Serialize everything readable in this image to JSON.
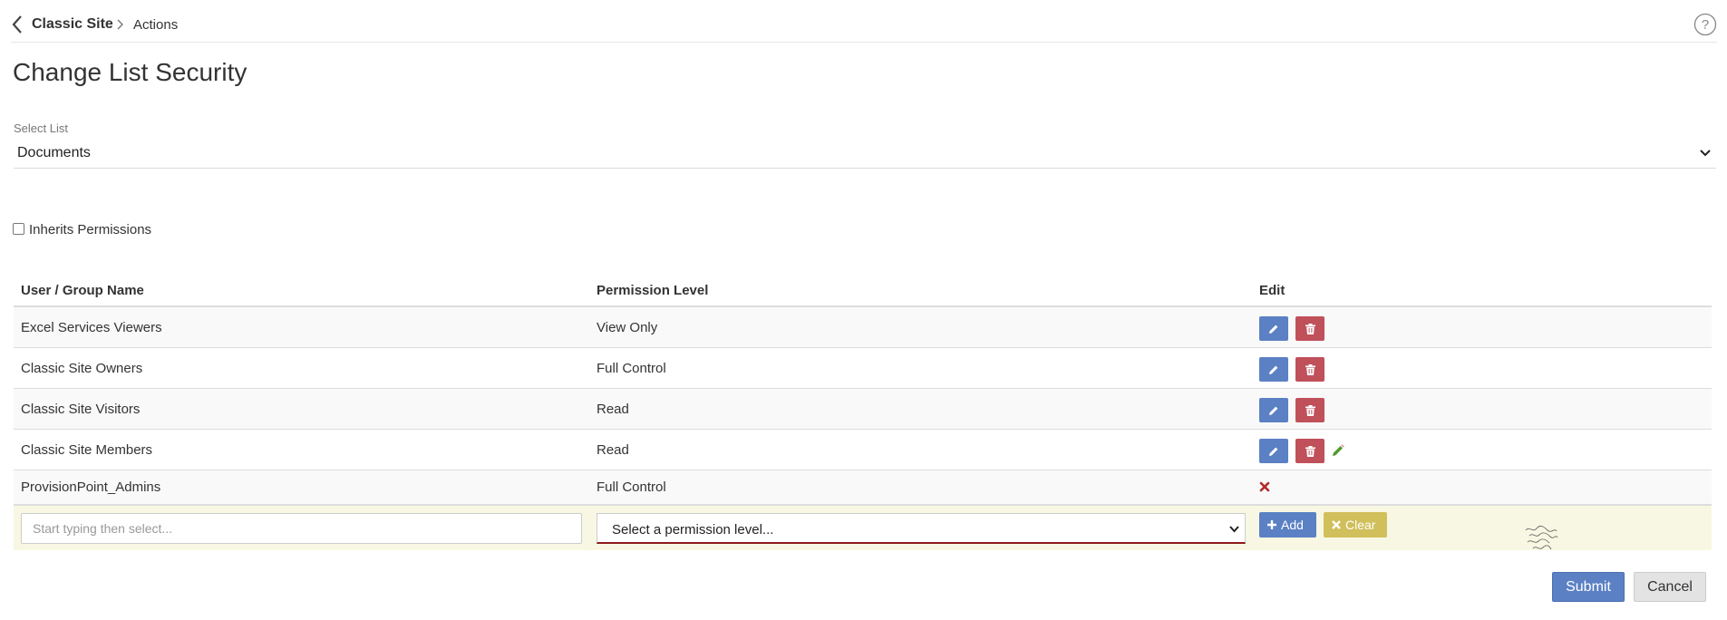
{
  "breadcrumb": {
    "site": "Classic Site",
    "current": "Actions"
  },
  "page": {
    "title": "Change List Security"
  },
  "list_select": {
    "label": "Select List",
    "value": "Documents"
  },
  "inherit": {
    "label": "Inherits Permissions",
    "checked": false
  },
  "table": {
    "headers": [
      "User / Group Name",
      "Permission Level",
      "Edit"
    ],
    "rows": [
      {
        "name": "Excel Services Viewers",
        "level": "View Only"
      },
      {
        "name": "Classic Site Owners",
        "level": "Full Control"
      },
      {
        "name": "Classic Site Visitors",
        "level": "Read"
      },
      {
        "name": "Classic Site Members",
        "level": "Read"
      },
      {
        "name": "ProvisionPoint_Admins",
        "level": "Full Control"
      }
    ]
  },
  "add_row": {
    "user_placeholder": "Start typing then select...",
    "permission_value": "Select a permission level...",
    "add_label": "Add",
    "clear_label": "Clear"
  },
  "actions": {
    "submit_label": "Submit",
    "cancel_label": "Cancel"
  },
  "colors": {
    "primary": "#5b80c4",
    "danger": "#c0505a",
    "warning": "#d0bf5a",
    "add_row_bg": "#f8f7e3"
  }
}
